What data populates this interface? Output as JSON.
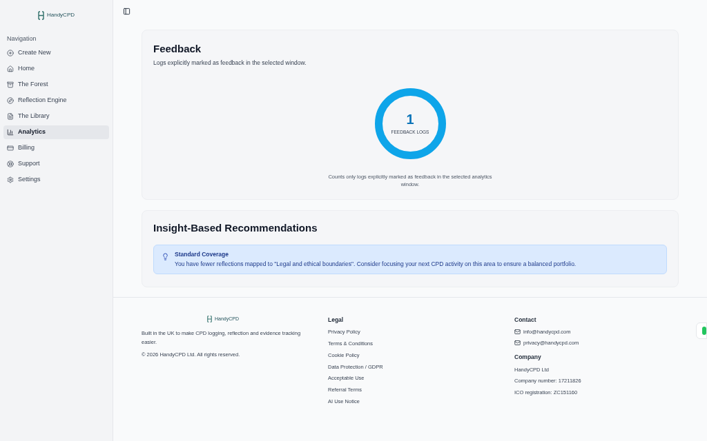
{
  "logo": {
    "text": "HandyCPD"
  },
  "sidebar": {
    "heading": "Navigation",
    "items": [
      {
        "label": "Create New",
        "selected": false
      },
      {
        "label": "Home",
        "selected": false
      },
      {
        "label": "The Forest",
        "selected": false
      },
      {
        "label": "Reflection Engine",
        "selected": false
      },
      {
        "label": "The Library",
        "selected": false
      },
      {
        "label": "Analytics",
        "selected": true
      },
      {
        "label": "Billing",
        "selected": false
      },
      {
        "label": "Support",
        "selected": false
      },
      {
        "label": "Settings",
        "selected": false
      }
    ]
  },
  "feedback": {
    "title": "Feedback",
    "subtitle": "Logs explicitly marked as feedback in the selected window.",
    "count": "1",
    "count_label": "FEEDBACK LOGS",
    "note": "Counts only logs explicitly marked as feedback in the selected analytics window."
  },
  "recommendations": {
    "title": "Insight-Based Recommendations",
    "items": [
      {
        "title": "Standard Coverage",
        "text": "You have fewer reflections mapped to \"Legal and ethical boundaries\". Consider focusing your next CPD activity on this area to ensure a balanced portfolio."
      }
    ]
  },
  "footer": {
    "logo": "HandyCPD",
    "tagline": "Built in the UK to make CPD logging, reflection and evidence tracking easier.",
    "copyright": "© 2026 HandyCPD Ltd. All rights reserved.",
    "legal": {
      "title": "Legal",
      "links": [
        "Privacy Policy",
        "Terms & Conditions",
        "Cookie Policy",
        "Data Protection / GDPR",
        "Acceptable Use",
        "Referral Terms",
        "AI Use Notice"
      ]
    },
    "contact": {
      "title": "Contact",
      "emails": [
        "info@handycpd.com",
        "privacy@handycpd.com"
      ]
    },
    "company": {
      "title": "Company",
      "lines": [
        "HandyCPD Ltd",
        "Company number: 17211826",
        "ICO registration: ZC151160"
      ]
    }
  }
}
